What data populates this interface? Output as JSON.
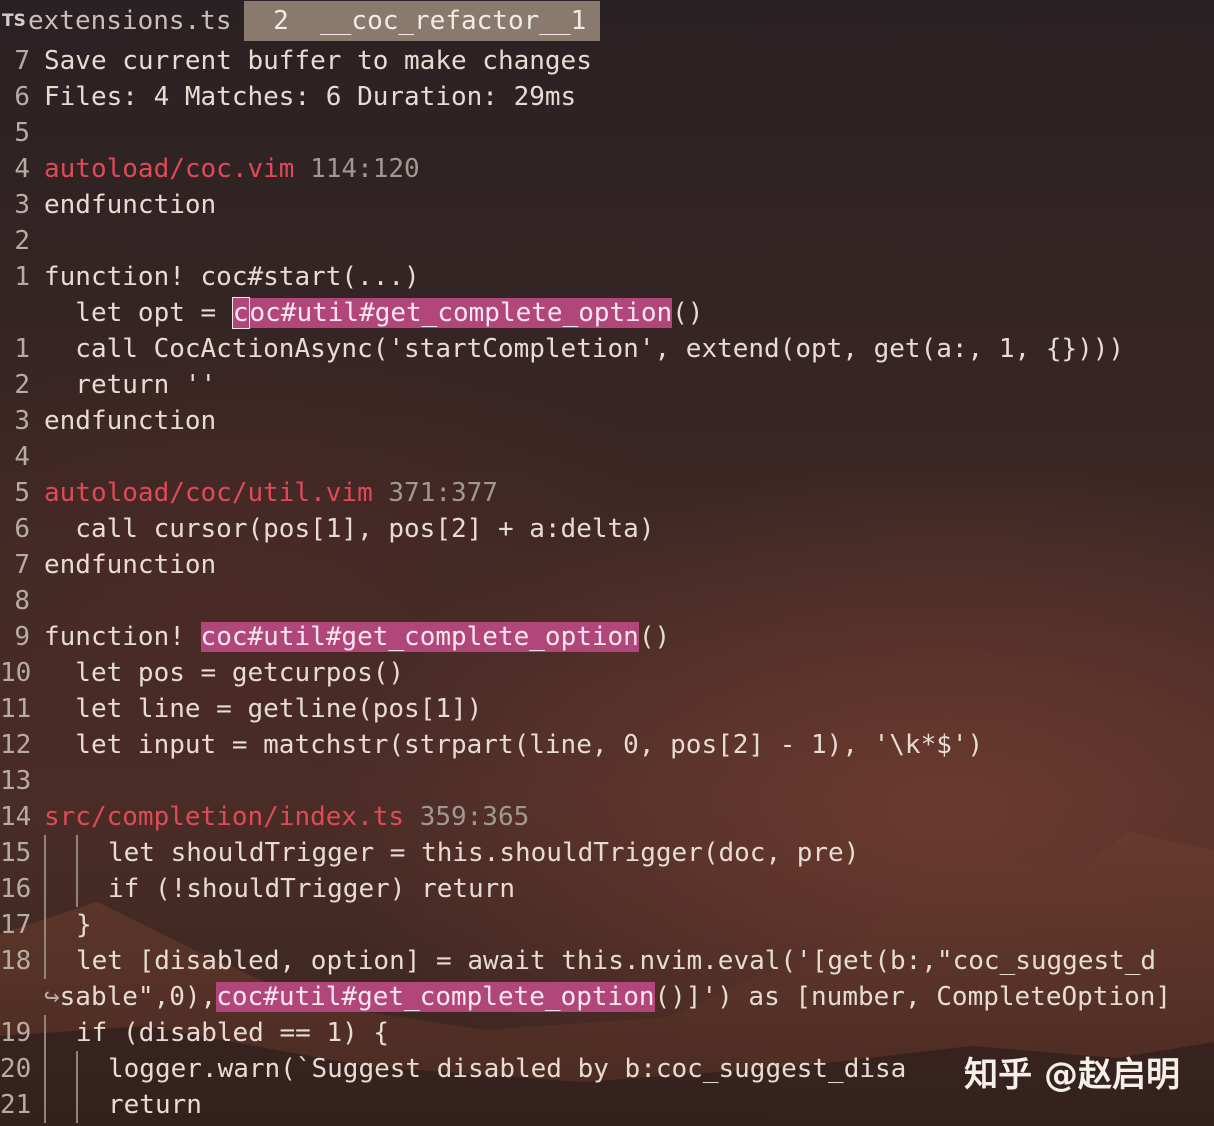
{
  "tabline": {
    "icon": "TS",
    "inactive_tab": "extensions.ts",
    "active_tab": " 2  __coc_refactor__1"
  },
  "lines": {
    "l0": {
      "num": "7",
      "text": "Save current buffer to make changes"
    },
    "l1": {
      "num": "6",
      "text": "Files: 4 Matches: 6 Duration: 29ms"
    },
    "l2": {
      "num": "5"
    },
    "l3": {
      "num": "4",
      "file": "autoload/coc.vim",
      "range": "114:120"
    },
    "l4": {
      "num": "3",
      "text": "endfunction"
    },
    "l5": {
      "num": "2"
    },
    "l6": {
      "num": "1",
      "text": "function! coc#start(...)"
    },
    "l7": {
      "num": "",
      "pre": "  let opt = ",
      "cursor": "c",
      "hl": "oc#util#get_complete_option",
      "post": "()"
    },
    "l8": {
      "num": "1",
      "text": "  call CocActionAsync('startCompletion', extend(opt, get(a:, 1, {})))"
    },
    "l9": {
      "num": "2",
      "text": "  return ''"
    },
    "l10": {
      "num": "3",
      "text": "endfunction"
    },
    "l11": {
      "num": "4"
    },
    "l12": {
      "num": "5",
      "file": "autoload/coc/util.vim",
      "range": "371:377"
    },
    "l13": {
      "num": "6",
      "text": "  call cursor(pos[1], pos[2] + a:delta)"
    },
    "l14": {
      "num": "7",
      "text": "endfunction"
    },
    "l15": {
      "num": "8"
    },
    "l16": {
      "num": "9",
      "pre": "function! ",
      "hl": "coc#util#get_complete_option",
      "post": "()"
    },
    "l17": {
      "num": "10",
      "text": "  let pos = getcurpos()"
    },
    "l18": {
      "num": "11",
      "text": "  let line = getline(pos[1])"
    },
    "l19": {
      "num": "12",
      "text": "  let input = matchstr(strpart(line, 0, pos[2] - 1), '\\k*$')"
    },
    "l20": {
      "num": "13"
    },
    "l21": {
      "num": "14",
      "file": "src/completion/index.ts",
      "range": "359:365"
    },
    "l22": {
      "num": "15",
      "text": "let shouldTrigger = this.shouldTrigger(doc, pre)"
    },
    "l23": {
      "num": "16",
      "text": "if (!shouldTrigger) return"
    },
    "l24": {
      "num": "17",
      "text": "}"
    },
    "l25": {
      "num": "18",
      "text": "let [disabled, option] = await this.nvim.eval('[get(b:,\"coc_suggest_d"
    },
    "l26": {
      "num": "",
      "wrap": "↪",
      "pre": "sable\",0),",
      "hl": "coc#util#get_complete_option",
      "post": "()]') as [number, CompleteOption]"
    },
    "l27": {
      "num": "19",
      "text": "if (disabled == 1) {"
    },
    "l28": {
      "num": "20",
      "text": "logger.warn(`Suggest disabled by b:coc_suggest_disa"
    },
    "l29": {
      "num": "21",
      "text": "return"
    }
  },
  "watermark": "知乎 @赵启明",
  "colors": {
    "file_path": "#e04a58",
    "match_highlight": "#b04679",
    "range": "#a19891"
  }
}
